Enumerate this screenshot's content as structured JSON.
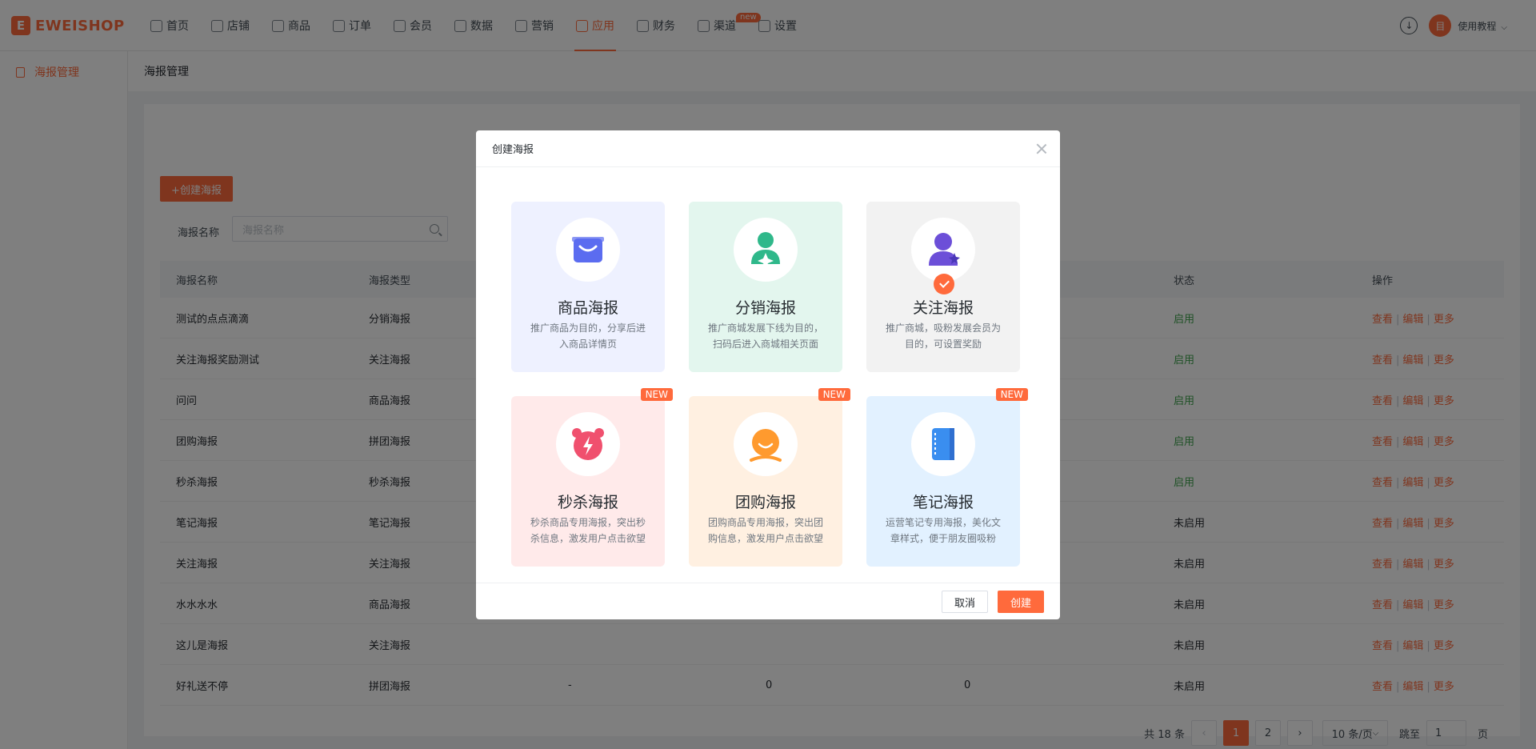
{
  "brand": {
    "name": "EWEISHOP",
    "mark": "E"
  },
  "nav": [
    {
      "label": "首页",
      "icon": "home-icon"
    },
    {
      "label": "店铺",
      "icon": "store-icon"
    },
    {
      "label": "商品",
      "icon": "goods-icon"
    },
    {
      "label": "订单",
      "icon": "order-icon"
    },
    {
      "label": "会员",
      "icon": "member-icon"
    },
    {
      "label": "数据",
      "icon": "data-icon"
    },
    {
      "label": "营销",
      "icon": "marketing-icon"
    },
    {
      "label": "应用",
      "icon": "app-icon",
      "active": true
    },
    {
      "label": "财务",
      "icon": "finance-icon"
    },
    {
      "label": "渠道",
      "icon": "channel-icon",
      "badge": "new"
    },
    {
      "label": "设置",
      "icon": "settings-icon"
    }
  ],
  "header_right": {
    "user_label": "使用教程",
    "avatar_text": "目"
  },
  "sidebar": {
    "item": "海报管理"
  },
  "page": {
    "title": "海报管理",
    "create_button": "+创建海报",
    "filter_label": "海报名称",
    "filter_placeholder": "海报名称"
  },
  "table": {
    "headers": [
      "海报名称",
      "海报类型",
      "",
      "",
      "",
      "状态",
      "操作"
    ],
    "ops": [
      "查看",
      "编辑",
      "更多"
    ],
    "rows": [
      {
        "name": "测试的点点滴滴",
        "type": "分销海报",
        "c3": "",
        "c4": "",
        "c5": "",
        "status": "启用",
        "on": true
      },
      {
        "name": "关注海报奖励测试",
        "type": "关注海报",
        "c3": "",
        "c4": "",
        "c5": "",
        "status": "启用",
        "on": true
      },
      {
        "name": "问问",
        "type": "商品海报",
        "c3": "",
        "c4": "",
        "c5": "",
        "status": "启用",
        "on": true
      },
      {
        "name": "团购海报",
        "type": "拼团海报",
        "c3": "",
        "c4": "",
        "c5": "",
        "status": "启用",
        "on": true
      },
      {
        "name": "秒杀海报",
        "type": "秒杀海报",
        "c3": "",
        "c4": "",
        "c5": "",
        "status": "启用",
        "on": true
      },
      {
        "name": "笔记海报",
        "type": "笔记海报",
        "c3": "",
        "c4": "",
        "c5": "",
        "status": "未启用",
        "on": false
      },
      {
        "name": "关注海报",
        "type": "关注海报",
        "c3": "",
        "c4": "",
        "c5": "",
        "status": "未启用",
        "on": false
      },
      {
        "name": "水水水水",
        "type": "商品海报",
        "c3": "",
        "c4": "",
        "c5": "",
        "status": "未启用",
        "on": false
      },
      {
        "name": "这儿是海报",
        "type": "关注海报",
        "c3": "",
        "c4": "",
        "c5": "",
        "status": "未启用",
        "on": false
      },
      {
        "name": "好礼送不停",
        "type": "拼团海报",
        "c3": "-",
        "c4": "0",
        "c5": "0",
        "status": "未启用",
        "on": false
      }
    ]
  },
  "pagination": {
    "total": "共 18 条",
    "pages": [
      "1",
      "2"
    ],
    "current": "1",
    "page_size": "10 条/页",
    "jump_label": "跳至",
    "jump_value": "1",
    "page_suffix": "页"
  },
  "modal": {
    "title": "创建海报",
    "cancel": "取消",
    "confirm": "创建",
    "cards": [
      {
        "title": "商品海报",
        "desc": "推广商品为目的，分享后进入商品详情页",
        "bg": "#eef1ff",
        "icon": "shopping-bag-icon",
        "icon_color": "#5b6cf0"
      },
      {
        "title": "分销海报",
        "desc": "推广商城发展下线为目的，扫码后进入商城相关页面",
        "bg": "#e3f6ee",
        "icon": "distributor-icon",
        "icon_color": "#2fb88a"
      },
      {
        "title": "关注海报",
        "desc": "推广商城，吸粉发展会员为目的，可设置奖励",
        "bg": "#f2f2f2",
        "icon": "follower-icon",
        "icon_color": "#6c4fd8",
        "selected": true
      },
      {
        "title": "秒杀海报",
        "desc": "秒杀商品专用海报，突出秒杀信息，激发用户点击欲望",
        "bg": "#ffeaea",
        "icon": "alarm-flash-icon",
        "icon_color": "#f0506e",
        "tag": "NEW"
      },
      {
        "title": "团购海报",
        "desc": "团购商品专用海报，突出团购信息，激发用户点击欲望",
        "bg": "#fff0e1",
        "icon": "group-buy-icon",
        "icon_color": "#ff9a2e",
        "tag": "NEW"
      },
      {
        "title": "笔记海报",
        "desc": "运营笔记专用海报，美化文章样式，便于朋友圈吸粉",
        "bg": "#e2f1ff",
        "icon": "notebook-icon",
        "icon_color": "#3a8ef0",
        "tag": "NEW"
      }
    ]
  }
}
